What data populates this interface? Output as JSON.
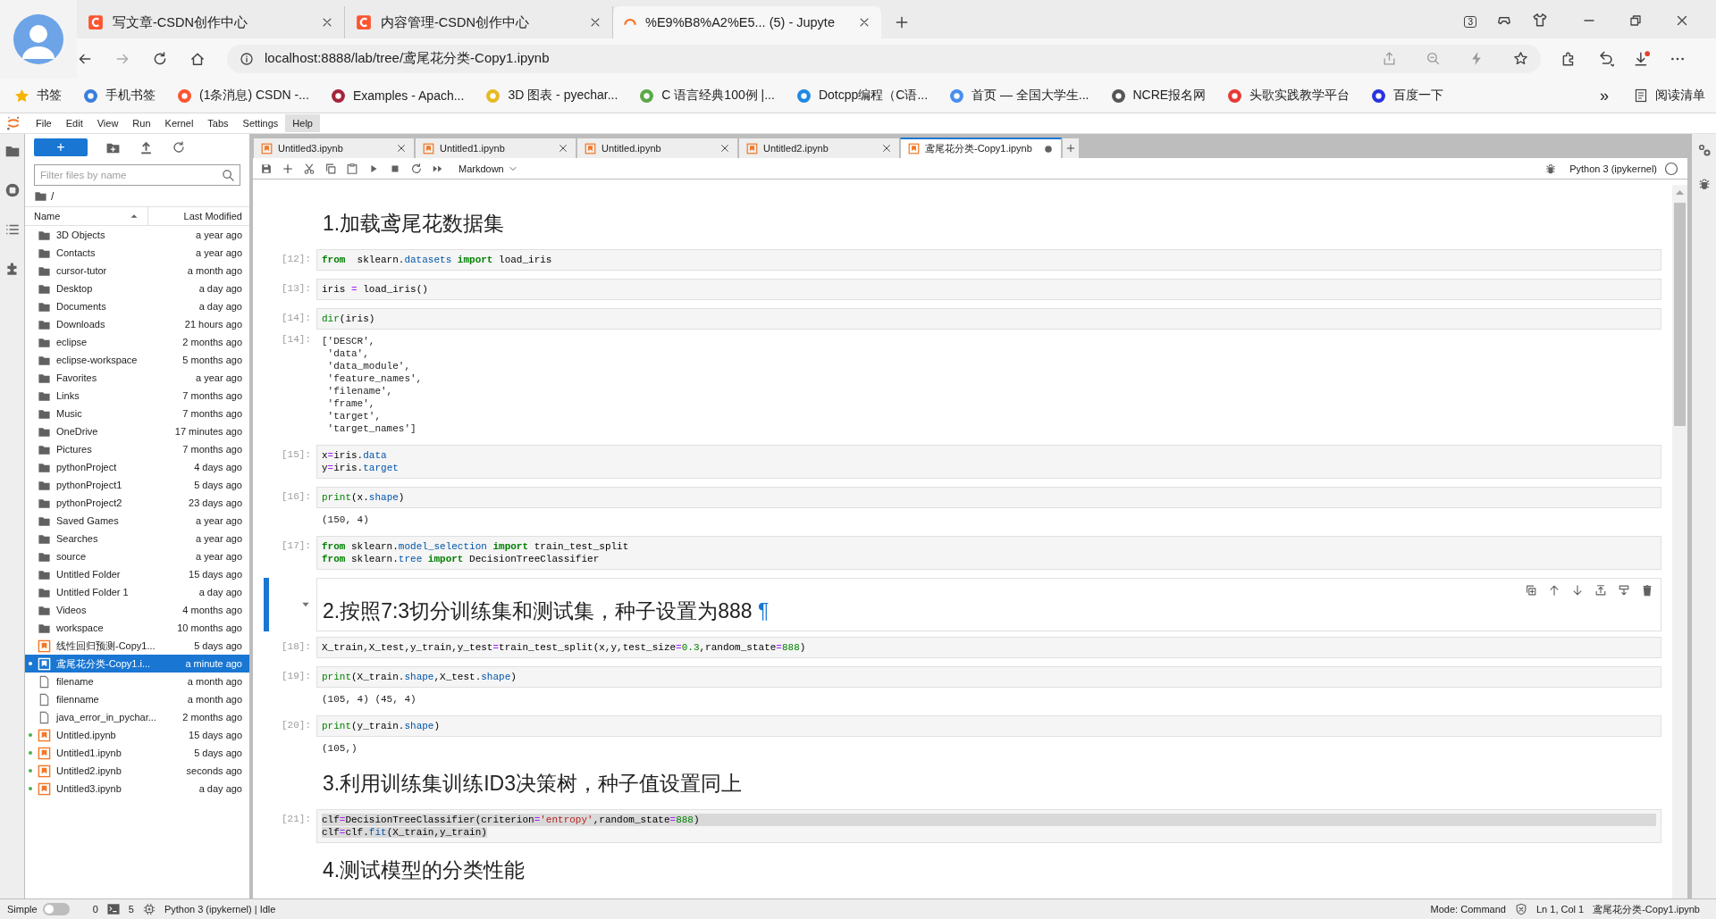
{
  "browser": {
    "tabs": [
      {
        "title": "写文章-CSDN创作中心",
        "selected": false,
        "kind": "csdn"
      },
      {
        "title": "内容管理-CSDN创作中心",
        "selected": false,
        "kind": "csdn"
      },
      {
        "title": "%E9%B8%A2%E5... (5) - Jupyte",
        "selected": true,
        "kind": "loading"
      }
    ],
    "tab_count": "3",
    "address": "localhost:8888/lab/tree/鸢尾花分类-Copy1.ipynb",
    "bookmarks": [
      {
        "label": "书签",
        "kind": "star",
        "color": "#f4b400"
      },
      {
        "label": "手机书签",
        "kind": "site",
        "color": "#3b7ddd"
      },
      {
        "label": "(1条消息) CSDN -...",
        "kind": "site",
        "color": "#fc5531"
      },
      {
        "label": "Examples - Apach...",
        "kind": "site",
        "color": "#a4243b"
      },
      {
        "label": "3D 图表 - pyechar...",
        "kind": "site",
        "color": "#e8b923"
      },
      {
        "label": "C 语言经典100例 |...",
        "kind": "site",
        "color": "#5aa847"
      },
      {
        "label": "Dotcpp编程（C语...",
        "kind": "site",
        "color": "#1e88e5"
      },
      {
        "label": "首页 — 全国大学生...",
        "kind": "site",
        "color": "#4a8ef0"
      },
      {
        "label": "NCRE报名网",
        "kind": "site",
        "color": "#555555"
      },
      {
        "label": "头歌实践教学平台",
        "kind": "site",
        "color": "#e53935"
      },
      {
        "label": "百度一下",
        "kind": "site",
        "color": "#2932e1"
      }
    ],
    "more": "»",
    "reading_list": "阅读清单"
  },
  "menu": [
    {
      "label": "File",
      "selected": false
    },
    {
      "label": "Edit",
      "selected": false
    },
    {
      "label": "View",
      "selected": false
    },
    {
      "label": "Run",
      "selected": false
    },
    {
      "label": "Kernel",
      "selected": false
    },
    {
      "label": "Tabs",
      "selected": false
    },
    {
      "label": "Settings",
      "selected": false
    },
    {
      "label": "Help",
      "selected": true
    }
  ],
  "file_browser": {
    "new_button": "+",
    "filter_placeholder": "Filter files by name",
    "path": "/",
    "columns": [
      "Name",
      "Last Modified"
    ],
    "files": [
      {
        "name": "3D Objects",
        "modified": "a year ago",
        "kind": "folder",
        "selected": false,
        "running": false
      },
      {
        "name": "Contacts",
        "modified": "a year ago",
        "kind": "folder",
        "selected": false,
        "running": false
      },
      {
        "name": "cursor-tutor",
        "modified": "a month ago",
        "kind": "folder",
        "selected": false,
        "running": false
      },
      {
        "name": "Desktop",
        "modified": "a day ago",
        "kind": "folder",
        "selected": false,
        "running": false
      },
      {
        "name": "Documents",
        "modified": "a day ago",
        "kind": "folder",
        "selected": false,
        "running": false
      },
      {
        "name": "Downloads",
        "modified": "21 hours ago",
        "kind": "folder",
        "selected": false,
        "running": false
      },
      {
        "name": "eclipse",
        "modified": "2 months ago",
        "kind": "folder",
        "selected": false,
        "running": false
      },
      {
        "name": "eclipse-workspace",
        "modified": "5 months ago",
        "kind": "folder",
        "selected": false,
        "running": false
      },
      {
        "name": "Favorites",
        "modified": "a year ago",
        "kind": "folder",
        "selected": false,
        "running": false
      },
      {
        "name": "Links",
        "modified": "7 months ago",
        "kind": "folder",
        "selected": false,
        "running": false
      },
      {
        "name": "Music",
        "modified": "7 months ago",
        "kind": "folder",
        "selected": false,
        "running": false
      },
      {
        "name": "OneDrive",
        "modified": "17 minutes ago",
        "kind": "folder",
        "selected": false,
        "running": false
      },
      {
        "name": "Pictures",
        "modified": "7 months ago",
        "kind": "folder",
        "selected": false,
        "running": false
      },
      {
        "name": "pythonProject",
        "modified": "4 days ago",
        "kind": "folder",
        "selected": false,
        "running": false
      },
      {
        "name": "pythonProject1",
        "modified": "5 days ago",
        "kind": "folder",
        "selected": false,
        "running": false
      },
      {
        "name": "pythonProject2",
        "modified": "23 days ago",
        "kind": "folder",
        "selected": false,
        "running": false
      },
      {
        "name": "Saved Games",
        "modified": "a year ago",
        "kind": "folder",
        "selected": false,
        "running": false
      },
      {
        "name": "Searches",
        "modified": "a year ago",
        "kind": "folder",
        "selected": false,
        "running": false
      },
      {
        "name": "source",
        "modified": "a year ago",
        "kind": "folder",
        "selected": false,
        "running": false
      },
      {
        "name": "Untitled Folder",
        "modified": "15 days ago",
        "kind": "folder",
        "selected": false,
        "running": false
      },
      {
        "name": "Untitled Folder 1",
        "modified": "a day ago",
        "kind": "folder",
        "selected": false,
        "running": false
      },
      {
        "name": "Videos",
        "modified": "4 months ago",
        "kind": "folder",
        "selected": false,
        "running": false
      },
      {
        "name": "workspace",
        "modified": "10 months ago",
        "kind": "folder",
        "selected": false,
        "running": false
      },
      {
        "name": "线性回归预测-Copy1...",
        "modified": "5 days ago",
        "kind": "notebook",
        "selected": false,
        "running": false
      },
      {
        "name": "鸢尾花分类-Copy1.i...",
        "modified": "a minute ago",
        "kind": "notebook",
        "selected": true,
        "running": true
      },
      {
        "name": "filename",
        "modified": "a month ago",
        "kind": "file",
        "selected": false,
        "running": false
      },
      {
        "name": "filenname",
        "modified": "a month ago",
        "kind": "file",
        "selected": false,
        "running": false
      },
      {
        "name": "java_error_in_pychar...",
        "modified": "2 months ago",
        "kind": "file",
        "selected": false,
        "running": false
      },
      {
        "name": "Untitled.ipynb",
        "modified": "15 days ago",
        "kind": "notebook",
        "selected": false,
        "running": true
      },
      {
        "name": "Untitled1.ipynb",
        "modified": "5 days ago",
        "kind": "notebook",
        "selected": false,
        "running": true
      },
      {
        "name": "Untitled2.ipynb",
        "modified": "seconds ago",
        "kind": "notebook",
        "selected": false,
        "running": true
      },
      {
        "name": "Untitled3.ipynb",
        "modified": "a day ago",
        "kind": "notebook",
        "selected": false,
        "running": true
      }
    ]
  },
  "notebook_tabs": [
    {
      "title": "Untitled3.ipynb",
      "selected": false,
      "dirty": false
    },
    {
      "title": "Untitled1.ipynb",
      "selected": false,
      "dirty": false
    },
    {
      "title": "Untitled.ipynb",
      "selected": false,
      "dirty": false
    },
    {
      "title": "Untitled2.ipynb",
      "selected": false,
      "dirty": false
    },
    {
      "title": "鸢尾花分类-Copy1.ipynb",
      "selected": true,
      "dirty": true
    }
  ],
  "toolbar": {
    "cell_type": "Markdown",
    "kernel": "Python 3 (ipykernel)",
    "kernel_busy": false
  },
  "cells": [
    {
      "kind": "markdown",
      "text": "1.加载鸢尾花数据集",
      "active": false
    },
    {
      "kind": "code",
      "prompt": "[12]:",
      "lines": [
        {
          "selected": false,
          "tokens": [
            {
              "text": "from",
              "kind": "keyword"
            },
            {
              "text": "  sklearn.",
              "kind": "text"
            },
            {
              "text": "datasets",
              "kind": "property"
            },
            {
              "text": " import",
              "kind": "keyword"
            },
            {
              "text": " load_iris",
              "kind": "text"
            }
          ]
        }
      ]
    },
    {
      "kind": "code",
      "prompt": "[13]:",
      "lines": [
        {
          "selected": false,
          "tokens": [
            {
              "text": "iris ",
              "kind": "text"
            },
            {
              "text": "=",
              "kind": "operator"
            },
            {
              "text": " load_iris()",
              "kind": "text"
            }
          ]
        }
      ]
    },
    {
      "kind": "code",
      "prompt": "[14]:",
      "lines": [
        {
          "selected": false,
          "tokens": [
            {
              "text": "dir",
              "kind": "builtin"
            },
            {
              "text": "(iris)",
              "kind": "text"
            }
          ]
        }
      ],
      "output_prompt": "[14]:",
      "output": [
        "['DESCR',",
        " 'data',",
        " 'data_module',",
        " 'feature_names',",
        " 'filename',",
        " 'frame',",
        " 'target',",
        " 'target_names']"
      ]
    },
    {
      "kind": "code",
      "prompt": "[15]:",
      "lines": [
        {
          "selected": false,
          "tokens": [
            {
              "text": "x",
              "kind": "text"
            },
            {
              "text": "=",
              "kind": "operator"
            },
            {
              "text": "iris.",
              "kind": "text"
            },
            {
              "text": "data",
              "kind": "property"
            }
          ]
        },
        {
          "selected": false,
          "tokens": [
            {
              "text": "y",
              "kind": "text"
            },
            {
              "text": "=",
              "kind": "operator"
            },
            {
              "text": "iris.",
              "kind": "text"
            },
            {
              "text": "target",
              "kind": "property"
            }
          ]
        }
      ]
    },
    {
      "kind": "code",
      "prompt": "[16]:",
      "lines": [
        {
          "selected": false,
          "tokens": [
            {
              "text": "print",
              "kind": "builtin"
            },
            {
              "text": "(x.",
              "kind": "text"
            },
            {
              "text": "shape",
              "kind": "property"
            },
            {
              "text": ")",
              "kind": "text"
            }
          ]
        }
      ],
      "output": [
        "(150, 4)"
      ]
    },
    {
      "kind": "code",
      "prompt": "[17]:",
      "lines": [
        {
          "selected": false,
          "tokens": [
            {
              "text": "from",
              "kind": "keyword"
            },
            {
              "text": " sklearn.",
              "kind": "text"
            },
            {
              "text": "model_selection",
              "kind": "property"
            },
            {
              "text": " import",
              "kind": "keyword"
            },
            {
              "text": " train_test_split",
              "kind": "text"
            }
          ]
        },
        {
          "selected": false,
          "tokens": [
            {
              "text": "from",
              "kind": "keyword"
            },
            {
              "text": " sklearn.",
              "kind": "text"
            },
            {
              "text": "tree",
              "kind": "property"
            },
            {
              "text": " import",
              "kind": "keyword"
            },
            {
              "text": " DecisionTreeClassifier",
              "kind": "text"
            }
          ]
        }
      ]
    },
    {
      "kind": "markdown",
      "text": "2.按照7:3切分训练集和测试集，种子设置为888",
      "active": true,
      "anchor": "¶"
    },
    {
      "kind": "code",
      "prompt": "[18]:",
      "lines": [
        {
          "selected": false,
          "tokens": [
            {
              "text": "X_train,X_test,y_train,y_test",
              "kind": "text"
            },
            {
              "text": "=",
              "kind": "operator"
            },
            {
              "text": "train_test_split(x,y,test_size",
              "kind": "text"
            },
            {
              "text": "=",
              "kind": "operator"
            },
            {
              "text": "0.3",
              "kind": "number"
            },
            {
              "text": ",random_state",
              "kind": "text"
            },
            {
              "text": "=",
              "kind": "operator"
            },
            {
              "text": "888",
              "kind": "number"
            },
            {
              "text": ")",
              "kind": "text"
            }
          ]
        }
      ]
    },
    {
      "kind": "code",
      "prompt": "[19]:",
      "lines": [
        {
          "selected": false,
          "tokens": [
            {
              "text": "print",
              "kind": "builtin"
            },
            {
              "text": "(X_train.",
              "kind": "text"
            },
            {
              "text": "shape",
              "kind": "property"
            },
            {
              "text": ",X_test.",
              "kind": "text"
            },
            {
              "text": "shape",
              "kind": "property"
            },
            {
              "text": ")",
              "kind": "text"
            }
          ]
        }
      ],
      "output": [
        "(105, 4) (45, 4)"
      ]
    },
    {
      "kind": "code",
      "prompt": "[20]:",
      "lines": [
        {
          "selected": false,
          "tokens": [
            {
              "text": "print",
              "kind": "builtin"
            },
            {
              "text": "(y_train.",
              "kind": "text"
            },
            {
              "text": "shape",
              "kind": "property"
            },
            {
              "text": ")",
              "kind": "text"
            }
          ]
        }
      ],
      "output": [
        "(105,)"
      ]
    },
    {
      "kind": "markdown",
      "text": "3.利用训练集训练ID3决策树，种子值设置同上",
      "active": false
    },
    {
      "kind": "code",
      "prompt": "[21]:",
      "lines": [
        {
          "selected": true,
          "tokens": [
            {
              "text": "clf",
              "kind": "text"
            },
            {
              "text": "=",
              "kind": "operator"
            },
            {
              "text": "DecisionTreeClassifier(criterion",
              "kind": "text"
            },
            {
              "text": "=",
              "kind": "operator"
            },
            {
              "text": "'entropy'",
              "kind": "string"
            },
            {
              "text": ",random_state",
              "kind": "text"
            },
            {
              "text": "=",
              "kind": "operator"
            },
            {
              "text": "888",
              "kind": "number"
            },
            {
              "text": ")",
              "kind": "text"
            }
          ]
        },
        {
          "selected": true,
          "tokens": [
            {
              "text": "clf",
              "kind": "text"
            },
            {
              "text": "=",
              "kind": "operator"
            },
            {
              "text": "clf.",
              "kind": "text"
            },
            {
              "text": "fit",
              "kind": "property"
            },
            {
              "text": "(X_train,y_train)",
              "kind": "text"
            }
          ]
        }
      ]
    },
    {
      "kind": "markdown",
      "text": "4.测试模型的分类性能",
      "active": false
    }
  ],
  "status_bar": {
    "mode_toggle": {
      "label": "Simple",
      "on": false
    },
    "terminals": "0",
    "kernels": "5",
    "kernel_status": "Python 3 (ipykernel) | Idle",
    "mode": "Mode: Command",
    "position": "Ln 1, Col 1",
    "document": "鸢尾花分类-Copy1.ipynb"
  }
}
